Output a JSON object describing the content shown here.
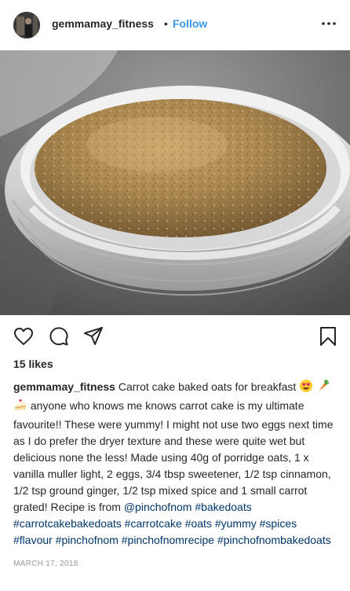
{
  "post": {
    "username": "gemmamay_fitness",
    "separator": "•",
    "follow_label": "Follow",
    "more_icon": "more-options-icon",
    "likes": "15 likes",
    "caption": {
      "username": "gemmamay_fitness",
      "text_1": " Carrot cake baked oats for breakfast ",
      "emojis": [
        "heart-eyes-emoji",
        "carrot-emoji",
        "cake-slice-emoji"
      ],
      "text_2": " anyone who knows me knows carrot cake is my ultimate favourite!! These were yummy! I might not use two eggs next time as I do prefer the dryer texture and these were quite wet but delicious none the less! Made using 40g of porridge oats, 1 x vanilla muller light, 2 eggs, 3/4 tbsp sweetener, 1/2 tsp cinnamon, 1/2 tsp ground ginger, 1/2 tsp mixed spice and 1 small carrot grated! Recipe is from ",
      "mention": "@pinchofnom",
      "hashtags": [
        "#bakedoats",
        "#carrotcakebakedoats",
        "#carrotcake",
        "#oats",
        "#yummy",
        "#spices",
        "#flavour",
        "#pinchofnom",
        "#pinchofnomrecipe",
        "#pinchofnombakedoats"
      ]
    },
    "date": "MARCH 17, 2018",
    "icons": {
      "like": "heart-icon",
      "comment": "comment-icon",
      "share": "share-icon",
      "save": "bookmark-icon"
    },
    "colors": {
      "link": "#3897f0",
      "hashtag": "#003569",
      "muted": "#999999",
      "text": "#262626"
    }
  }
}
